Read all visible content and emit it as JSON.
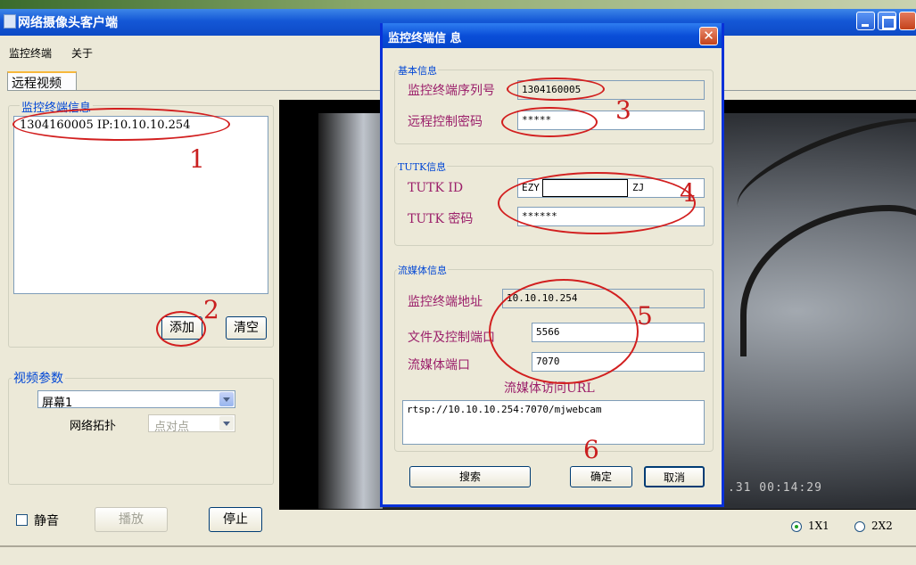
{
  "app": {
    "title": "网络摄像头客户端"
  },
  "menu": {
    "items": [
      "监控终端",
      "关于"
    ]
  },
  "tabs": {
    "active": "远程视频"
  },
  "terminal_group": {
    "label": "监控终端信息",
    "list": [
      "1304160005  IP:10.10.10.254"
    ],
    "add_label": "添加",
    "clear_label": "清空"
  },
  "video_params": {
    "label": "视频参数",
    "screen_value": "屏幕1",
    "topology_label": "网络拓扑",
    "topology_value": "点对点"
  },
  "controls": {
    "mute_label": "静音",
    "play_label": "播放",
    "stop_label": "停止"
  },
  "layout_options": {
    "one": "1X1",
    "two": "2X2",
    "selected": "1X1"
  },
  "video": {
    "timestamp": ".31 00:14:29"
  },
  "dialog": {
    "title": "监控终端信 息",
    "basic": {
      "label": "基本信息",
      "serial_label": "监控终端序列号",
      "serial_value": "1304160005",
      "password_label": "远程控制密码",
      "password_value": "*****"
    },
    "tutk": {
      "label": "TUTK信息",
      "id_label": "TUTK ID",
      "id_prefix": "EZY",
      "id_suffix": "ZJ",
      "password_label": "TUTK 密码",
      "password_value": "******"
    },
    "stream": {
      "label": "流媒体信息",
      "address_label": "监控终端地址",
      "address_value": "10.10.10.254",
      "file_port_label": "文件及控制端口",
      "file_port_value": "5566",
      "media_port_label": "流媒体端口",
      "media_port_value": "7070",
      "url_label": "流媒体访问URL",
      "url_value": "rtsp://10.10.10.254:7070/mjwebcam"
    },
    "buttons": {
      "search": "搜索",
      "ok": "确定",
      "cancel": "取消"
    }
  },
  "annotations": [
    "1",
    "2",
    "3",
    "4",
    "5",
    "6"
  ],
  "colors": {
    "annotation": "#d21f1f",
    "titlebar": "#0a4ed8",
    "label": "#9b1f6a"
  }
}
